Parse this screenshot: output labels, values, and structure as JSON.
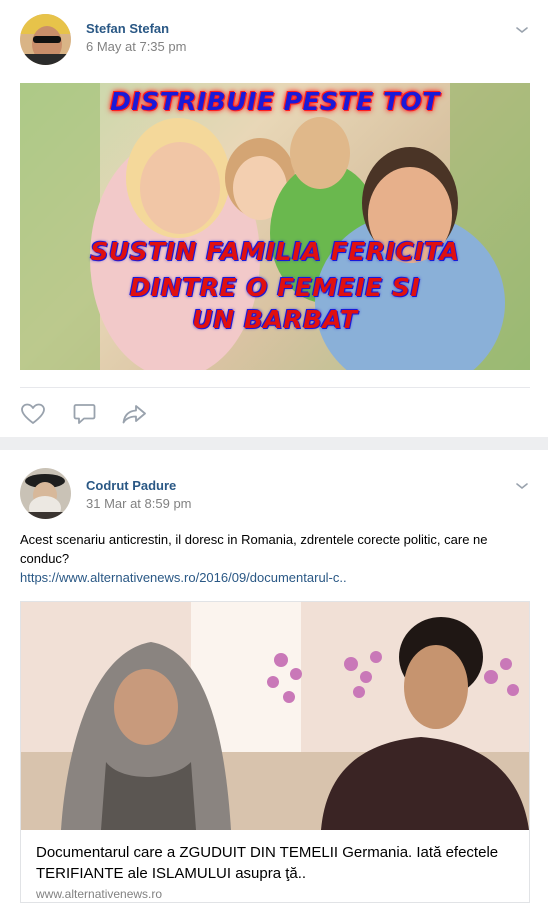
{
  "posts": [
    {
      "author": "Stefan Stefan",
      "timestamp": "6 May at 7:35 pm",
      "image": {
        "overlay_top": "DISTRIBUIE PESTE TOT",
        "overlay_lines": [
          "SUSTIN FAMILIA FERICITA",
          "DINTRE O FEMEIE SI",
          "UN BARBAT"
        ]
      },
      "actions": [
        "heart-icon",
        "comment-icon",
        "share-icon"
      ]
    },
    {
      "author": "Codrut Padure",
      "timestamp": "31 Mar at 8:59 pm",
      "text": "Acest scenariu anticrestin, il doresc in Romania, zdrentele corecte politic, care ne conduc?",
      "link": "https://www.alternativenews.ro/2016/09/documentarul-c..",
      "card": {
        "title": "Documentarul care a ZGUDUIT DIN TEMELII Germania. Iată efectele TERIFIANTE ale ISLAMULUI asupra ţă..",
        "domain": "www.alternativenews.ro"
      }
    }
  ],
  "colors": {
    "author": "#2a5885",
    "meta": "#828282",
    "icon": "#99a2ad",
    "background": "#edeef0"
  }
}
